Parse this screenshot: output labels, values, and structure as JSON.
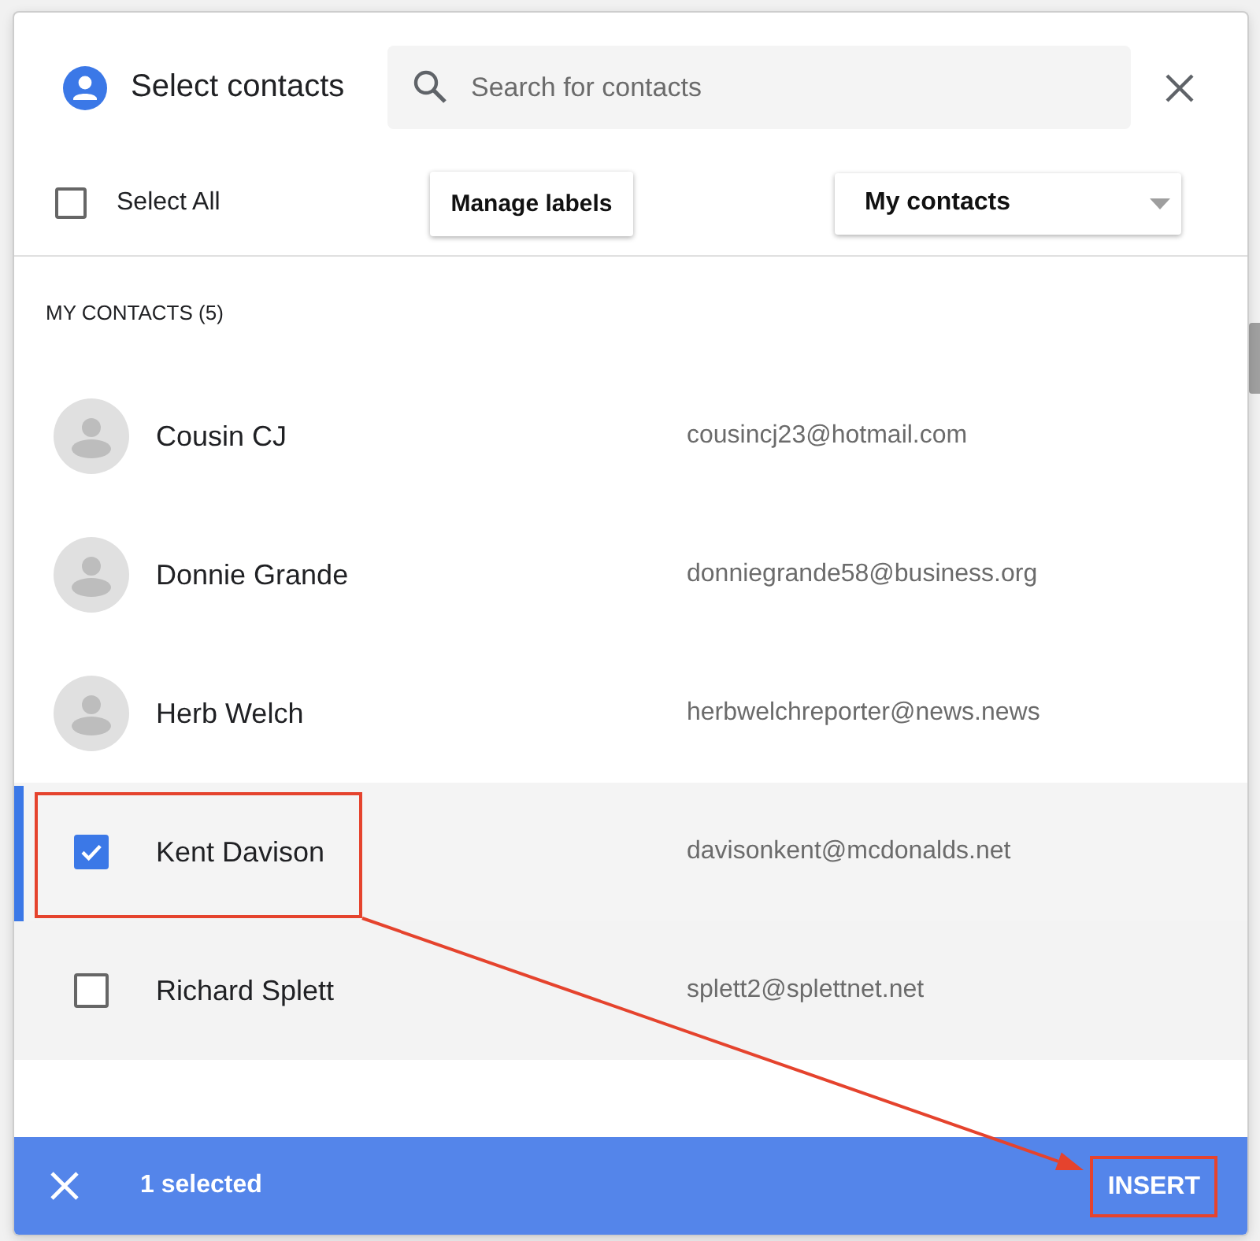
{
  "dialog": {
    "title": "Select contacts"
  },
  "search": {
    "placeholder": "Search for contacts"
  },
  "toolbar": {
    "select_all": {
      "label": "Select All",
      "checked": false
    },
    "manage_labels": "Manage labels",
    "filter": {
      "value": "My contacts"
    }
  },
  "section": {
    "heading": "MY CONTACTS (5)"
  },
  "contacts": [
    {
      "name": "Cousin CJ",
      "email": "cousincj23@hotmail.com",
      "checked": false,
      "hovered": false,
      "highlighted": false
    },
    {
      "name": "Donnie Grande",
      "email": "donniegrande58@business.org",
      "checked": false,
      "hovered": false,
      "highlighted": false
    },
    {
      "name": "Herb Welch",
      "email": "herbwelchreporter@news.news",
      "checked": false,
      "hovered": false,
      "highlighted": false
    },
    {
      "name": "Kent Davison",
      "email": "davisonkent@mcdonalds.net",
      "checked": true,
      "hovered": false,
      "highlighted": true
    },
    {
      "name": "Richard Splett",
      "email": "splett2@splettnet.net",
      "checked": false,
      "hovered": true,
      "highlighted": false
    }
  ],
  "footer": {
    "count": "1 selected",
    "insert": {
      "label": "INSERT",
      "highlighted": true
    }
  }
}
